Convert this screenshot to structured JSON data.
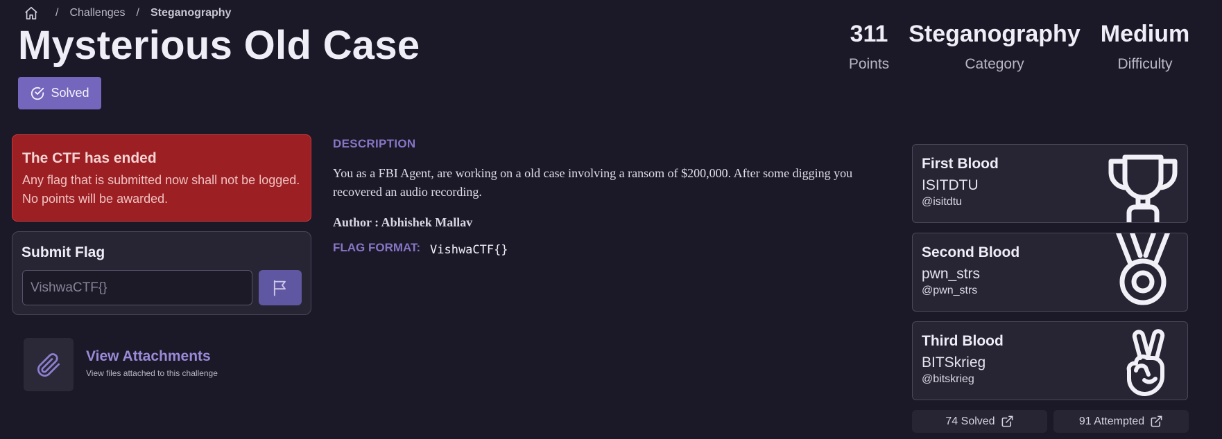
{
  "breadcrumb": {
    "home_icon": "home-icon",
    "separator": "/",
    "challenges": "Challenges",
    "current": "Steganography"
  },
  "challenge": {
    "title": "Mysterious Old Case",
    "solved_label": "Solved",
    "solved_icon": "check-circle-icon"
  },
  "stats": {
    "points_value": "311",
    "points_label": "Points",
    "category_value": "Steganography",
    "category_label": "Category",
    "difficulty_value": "Medium",
    "difficulty_label": "Difficulty"
  },
  "alert": {
    "title": "The CTF has ended",
    "text": "Any flag that is submitted now shall not be logged. No points will be awarded."
  },
  "submit": {
    "title": "Submit Flag",
    "placeholder": "VishwaCTF{}",
    "button_icon": "flag-icon"
  },
  "attachments": {
    "icon": "paperclip-icon",
    "title": "View Attachments",
    "subtitle": "View files attached to this challenge"
  },
  "description": {
    "heading": "DESCRIPTION",
    "text": "You as a FBI Agent, are working on a old case involving a ransom of $200,000. After some digging you recovered an audio recording.",
    "author": "Author : Abhishek Mallav",
    "format_label": "FLAG FORMAT:",
    "format_value": "VishwaCTF{}"
  },
  "bloods": {
    "first": {
      "title": "First Blood",
      "name": "ISITDTU",
      "handle": "@isitdtu",
      "icon": "trophy-icon"
    },
    "second": {
      "title": "Second Blood",
      "name": "pwn_strs",
      "handle": "@pwn_strs",
      "icon": "medal-icon"
    },
    "third": {
      "title": "Third Blood",
      "name": "BITSkrieg",
      "handle": "@bitskrieg",
      "icon": "victory-hand-icon"
    }
  },
  "counters": {
    "solved": "74 Solved",
    "attempted": "91 Attempted",
    "icon": "external-link-icon"
  },
  "colors": {
    "background": "#1b1827",
    "accent": "#7466bd",
    "alert": "#9b1f23",
    "card": "#272534"
  }
}
